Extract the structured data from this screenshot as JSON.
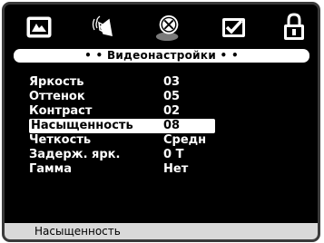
{
  "tabs": [
    {
      "name": "picture",
      "icon": "picture-icon"
    },
    {
      "name": "audio",
      "icon": "speaker-icon"
    },
    {
      "name": "video",
      "icon": "video-disc-icon"
    },
    {
      "name": "preferences",
      "icon": "checkbox-icon"
    },
    {
      "name": "lock",
      "icon": "lock-icon"
    }
  ],
  "title": "• • Видеонастройки • •",
  "items": [
    {
      "label": "Яркость",
      "value": "03"
    },
    {
      "label": "Оттенок",
      "value": "05"
    },
    {
      "label": "Контраст",
      "value": "02"
    },
    {
      "label": "Насыщенность",
      "value": "08",
      "selected": true
    },
    {
      "label": "Четкость",
      "value": "Средн"
    },
    {
      "label": "Задерж. ярк.",
      "value": "0 T"
    },
    {
      "label": "Гамма",
      "value": "Нет"
    }
  ],
  "status": "Насыщенность"
}
